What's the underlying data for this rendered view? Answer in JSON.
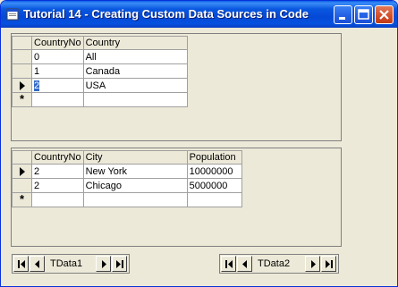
{
  "window": {
    "title": "Tutorial 14 - Creating Custom Data Sources in Code"
  },
  "grid_top": {
    "columns": [
      "CountryNo",
      "Country"
    ],
    "rows": [
      {
        "cells": [
          "0",
          "All"
        ],
        "indicator": ""
      },
      {
        "cells": [
          "1",
          "Canada"
        ],
        "indicator": ""
      },
      {
        "cells": [
          "2",
          "USA"
        ],
        "indicator": "current"
      }
    ],
    "new_row_indicator": "*"
  },
  "grid_bottom": {
    "columns": [
      "CountryNo",
      "City",
      "Population"
    ],
    "rows": [
      {
        "cells": [
          "2",
          "New York",
          "10000000"
        ],
        "indicator": "current"
      },
      {
        "cells": [
          "2",
          "Chicago",
          "5000000"
        ],
        "indicator": ""
      }
    ],
    "new_row_indicator": "*"
  },
  "nav_left": {
    "caption": "TData1"
  },
  "nav_right": {
    "caption": "TData2"
  },
  "colors": {
    "titlebar": "#0549d6",
    "window_bg": "#ece9d8",
    "selection": "#316ac5"
  }
}
